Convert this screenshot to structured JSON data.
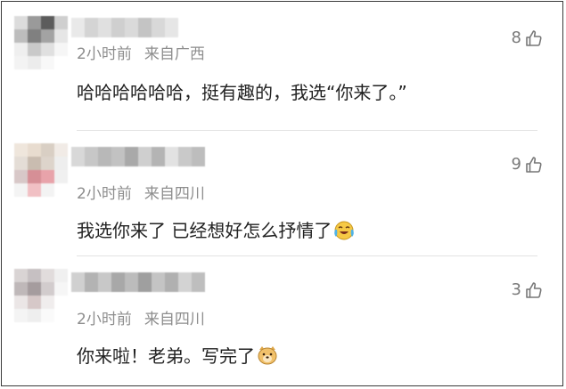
{
  "comments": [
    {
      "time": "2小时前",
      "location": "来自广西",
      "text": "哈哈哈哈哈哈，挺有趣的，我选“你来了。”",
      "likes": "8",
      "avatar_colors": [
        "#dcdcdc",
        "#9a9a9a",
        "#5c5c5c",
        "#cfcfcf",
        "#bdbdbd",
        "#808080",
        "#a3a3a3",
        "#e6e6e6",
        "#efefef",
        "#c9c9c9",
        "#e0e0e0",
        "#f6f6f6",
        "#f3f3f3",
        "#ececec",
        "#f8f8f8",
        "#ffffff"
      ],
      "name_colors": [
        "#e9e9e9",
        "#d4d4d4",
        "#e0e0e0",
        "#cfcfcf",
        "#dadada",
        "#c4c4c4",
        "#d8d8d8",
        "#e6e6e6"
      ]
    },
    {
      "time": "2小时前",
      "location": "来自四川",
      "text": "我选你来了 已经想好怎么抒情了",
      "likes": "9",
      "emoji": "laugh-cry-emoji",
      "avatar_colors": [
        "#efe6dc",
        "#e8dccf",
        "#d9cfc4",
        "#f1ebe6",
        "#e4ddd6",
        "#c9bcb0",
        "#ddd4cb",
        "#eeeeee",
        "#d8c8c8",
        "#d68f96",
        "#e8a3aa",
        "#f0f0f0",
        "#f4f4f4",
        "#f1c0c4",
        "#f3f3f3",
        "#ffffff"
      ],
      "name_colors": [
        "#d8d8d8",
        "#c7c7c7",
        "#b8b8b8",
        "#c2c2c2",
        "#a9a9a9",
        "#cfcfcf",
        "#b4b4b4",
        "#e2e2e2",
        "#c9c9c9",
        "#bdbdbd"
      ]
    },
    {
      "time": "2小时前",
      "location": "来自四川",
      "text": "你来啦！老弟。写完了",
      "likes": "3",
      "emoji": "doge-emoji",
      "avatar_colors": [
        "#d9d4d4",
        "#c6c0c2",
        "#e1dcdc",
        "#f0f0f0",
        "#bfb8b9",
        "#a59c9e",
        "#d2cccd",
        "#f6f6f6",
        "#ebe6e6",
        "#d6c8c8",
        "#f0eded",
        "#ffffff",
        "#f4f4f4",
        "#eeeeee",
        "#fafafa",
        "#ffffff"
      ],
      "name_colors": [
        "#d0d0d0",
        "#b3b3b3",
        "#c8c8c8",
        "#a8a8a8",
        "#bcbcbc",
        "#9f9f9f",
        "#c4c4c4",
        "#b0b0b0",
        "#d3d3d3",
        "#bebebe"
      ]
    }
  ],
  "like_icon": "thumbs-up-icon"
}
